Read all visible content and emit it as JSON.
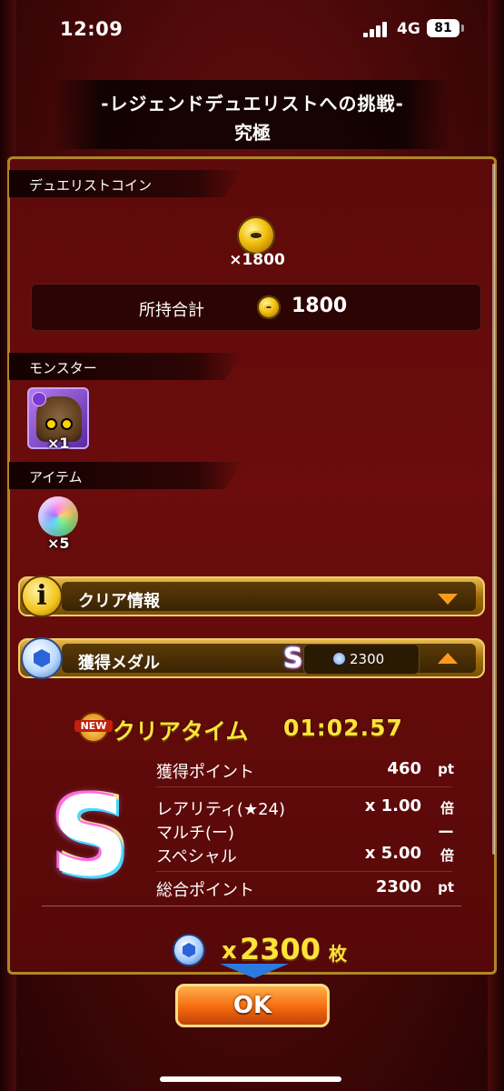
{
  "status_bar": {
    "time": "12:09",
    "network": "4G",
    "battery": "81"
  },
  "title": {
    "line1": "-レジェンドデュエリストへの挑戦-",
    "line2": "究極"
  },
  "duelist_coin": {
    "section_label": "デュエリストコイン",
    "reward_count": "×1800",
    "total_label": "所持合計",
    "total_value": "1800"
  },
  "monster": {
    "section_label": "モンスター",
    "count": "×1"
  },
  "item": {
    "section_label": "アイテム",
    "count": "×5"
  },
  "clear_info": {
    "label": "クリア情報"
  },
  "medal": {
    "label": "獲得メダル",
    "grade": "S",
    "value": "2300"
  },
  "details": {
    "new_badge": "NEW",
    "clear_time_label": "クリアタイム",
    "clear_time": "01:02.57",
    "grade": "S",
    "rows": [
      {
        "label": "獲得ポイント",
        "value": "460",
        "unit": "pt"
      },
      {
        "label": "レアリティ(★24)",
        "value": "x 1.00",
        "unit": "倍"
      },
      {
        "label": "マルチ(ー)",
        "value": "ー",
        "unit": ""
      },
      {
        "label": "スペシャル",
        "value": "x 5.00",
        "unit": "倍"
      },
      {
        "label": "総合ポイント",
        "value": "2300",
        "unit": "pt"
      }
    ],
    "reward": {
      "prefix": "x",
      "amount": "2300",
      "unit": "枚"
    }
  },
  "ok_button": "OK"
}
